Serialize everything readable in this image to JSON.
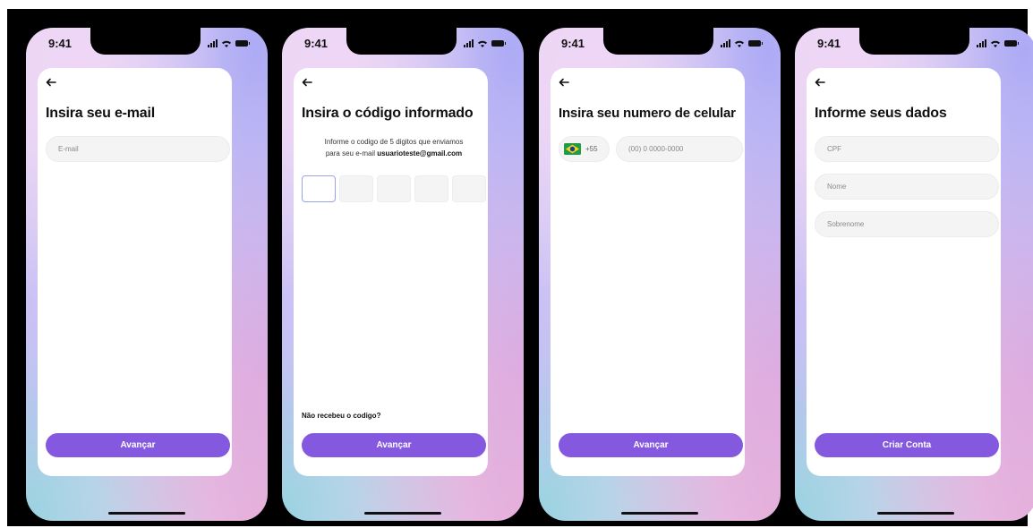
{
  "screens": [
    {
      "status_time": "9:41",
      "title": "Insira seu e-mail",
      "email_placeholder": "E-mail",
      "button_label": "Avançar"
    },
    {
      "status_time": "9:41",
      "title": "Insira o código informado",
      "subtitle_line1": "Informe o codigo de 5 digitos que enviamos",
      "subtitle_line2_prefix": "para seu e-mail ",
      "subtitle_email": "usuarioteste@gmail.com",
      "code_length": 5,
      "resend_label": "Não recebeu o codigo?",
      "button_label": "Avançar"
    },
    {
      "status_time": "9:41",
      "title": "Insira seu numero de celular",
      "country_code": "+55",
      "country_flag_icon": "brazil-flag-icon",
      "phone_placeholder": "(00) 0 0000-0000",
      "button_label": "Avançar"
    },
    {
      "status_time": "9:41",
      "title": "Informe seus dados",
      "cpf_placeholder": "CPF",
      "first_name_placeholder": "Nome",
      "last_name_placeholder": "Sobrenome",
      "button_label": "Criar Conta"
    }
  ],
  "colors": {
    "primary": "#8459e0",
    "canvas": "#000000",
    "card": "#ffffff",
    "field": "#f4f4f4",
    "code_active_border": "#9aa3e8"
  }
}
